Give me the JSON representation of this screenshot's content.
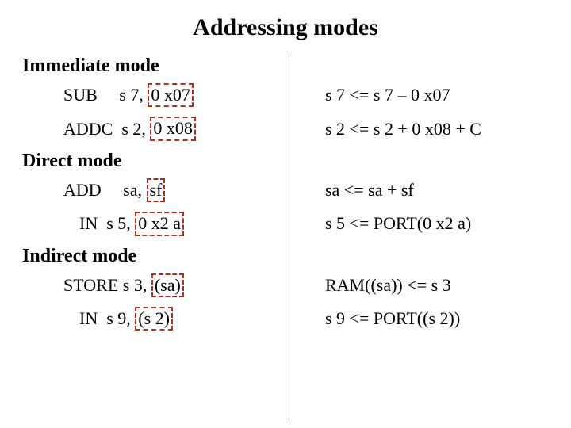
{
  "title": "Addressing modes",
  "sections": {
    "immediate": {
      "heading": "Immediate mode",
      "rows": [
        {
          "instr_pre": "SUB     s 7, ",
          "operand": "0 x07",
          "result": "s 7 <= s 7 – 0 x07"
        },
        {
          "instr_pre": "ADDC  s 2, ",
          "operand": "0 x08",
          "result": "s 2 <= s 2 + 0 x08 + C"
        }
      ]
    },
    "direct": {
      "heading": "Direct mode",
      "rows": [
        {
          "instr_pre": "ADD     sa, ",
          "operand": "sf",
          "result": "sa <= sa + sf"
        },
        {
          "instr_pre": "IN  s 5, ",
          "operand": "0 x2 a",
          "result": "s 5 <= PORT(0 x2 a)"
        }
      ]
    },
    "indirect": {
      "heading": "Indirect mode",
      "rows": [
        {
          "instr_pre": "STORE s 3, ",
          "operand": "(sa)",
          "result": "RAM((sa)) <= s 3"
        },
        {
          "instr_pre": "IN  s 9, ",
          "operand": "(s 2)",
          "result": "s 9 <= PORT((s 2))"
        }
      ]
    }
  }
}
